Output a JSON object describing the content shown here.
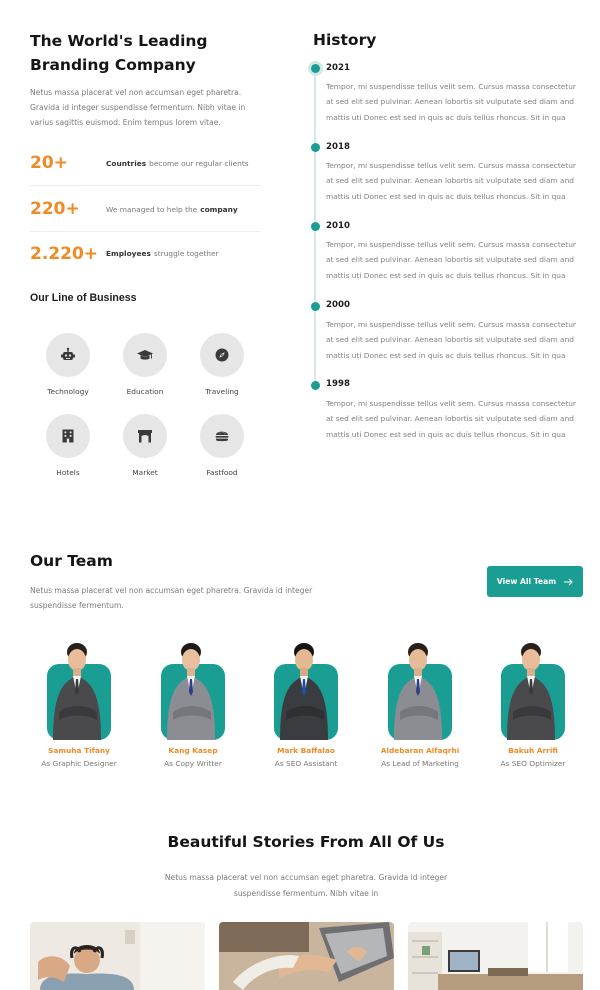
{
  "intro": {
    "title_line1": "The World's Leading",
    "title_line2": "Branding Company",
    "text": "Netus massa placerat vel non accumsan eget pharetra. Gravida id integer suspendisse fermentum. Nibh vitae in varius sagittis euismod. Enim tempus lorem vitae."
  },
  "stats": [
    {
      "number": "20+",
      "bold": "Countries",
      "after": "become our regular clients",
      "before": ""
    },
    {
      "number": "220+",
      "before": "We managed to help the",
      "bold": "company",
      "after": ""
    },
    {
      "number": "2.220+",
      "bold": "Employees",
      "after": "struggle together",
      "before": ""
    }
  ],
  "line_of_business": {
    "title": "Our Line of Business",
    "items": [
      {
        "label": "Technology",
        "icon": "robot-icon"
      },
      {
        "label": "Education",
        "icon": "graduation-cap-icon"
      },
      {
        "label": "Traveling",
        "icon": "compass-icon"
      },
      {
        "label": "Hotels",
        "icon": "hotel-icon"
      },
      {
        "label": "Market",
        "icon": "store-icon"
      },
      {
        "label": "Fastfood",
        "icon": "burger-icon"
      }
    ]
  },
  "history": {
    "title": "History",
    "entries": [
      {
        "year": "2021",
        "text": "Tempor, mi suspendisse tellus velit sem. Cursus massa consectetur at sed elit sed pulvinar. Aenean lobortis sit vulputate sed diam and mattis uti Donec est sed in quis ac duis tellus rhoncus. Sit in qua"
      },
      {
        "year": "2018",
        "text": "Tempor, mi suspendisse tellus velit sem. Cursus massa consectetur at sed elit sed pulvinar. Aenean lobortis sit vulputate sed diam and mattis uti Donec est sed in quis ac duis tellus rhoncus. Sit in qua"
      },
      {
        "year": "2010",
        "text": "Tempor, mi suspendisse tellus velit sem. Cursus massa consectetur at sed elit sed pulvinar. Aenean lobortis sit vulputate sed diam and mattis uti Donec est sed in quis ac duis tellus rhoncus. Sit in qua"
      },
      {
        "year": "2000",
        "text": "Tempor, mi suspendisse tellus velit sem. Cursus massa consectetur at sed elit sed pulvinar. Aenean lobortis sit vulputate sed diam and mattis uti Donec est sed in quis ac duis tellus rhoncus. Sit in qua"
      },
      {
        "year": "1998",
        "text": "Tempor, mi suspendisse tellus velit sem. Cursus massa consectetur at sed elit sed pulvinar. Aenean lobortis sit vulputate sed diam and mattis uti Donec est sed in quis ac duis tellus rhoncus. Sit in qua"
      }
    ]
  },
  "team": {
    "title": "Our Team",
    "text": "Netus massa placerat vel non accumsan eget pharetra. Gravida id integer suspendisse fermentum.",
    "button_label": "View All Team",
    "button_icon": "arrow-right-icon",
    "members": [
      {
        "name": "Samuha Tifany",
        "role": "As Graphic Designer"
      },
      {
        "name": "Kang Kasep",
        "role": "As Copy Writter"
      },
      {
        "name": "Mark Baffalao",
        "role": "As SEO Assistant"
      },
      {
        "name": "Aldebaran Alfaqrhi",
        "role": "As Lead of Marketing"
      },
      {
        "name": "Bakuh Arrifi",
        "role": "As SEO Optimizer"
      }
    ]
  },
  "stories": {
    "title": "Beautiful Stories From All Of Us",
    "text": "Netus massa placerat vel non accumsan eget pharetra. Gravida id integer suspendisse fermentum. Nibh vitae in"
  },
  "colors": {
    "accent_teal": "#1a9e94",
    "accent_orange": "#f08a24"
  }
}
